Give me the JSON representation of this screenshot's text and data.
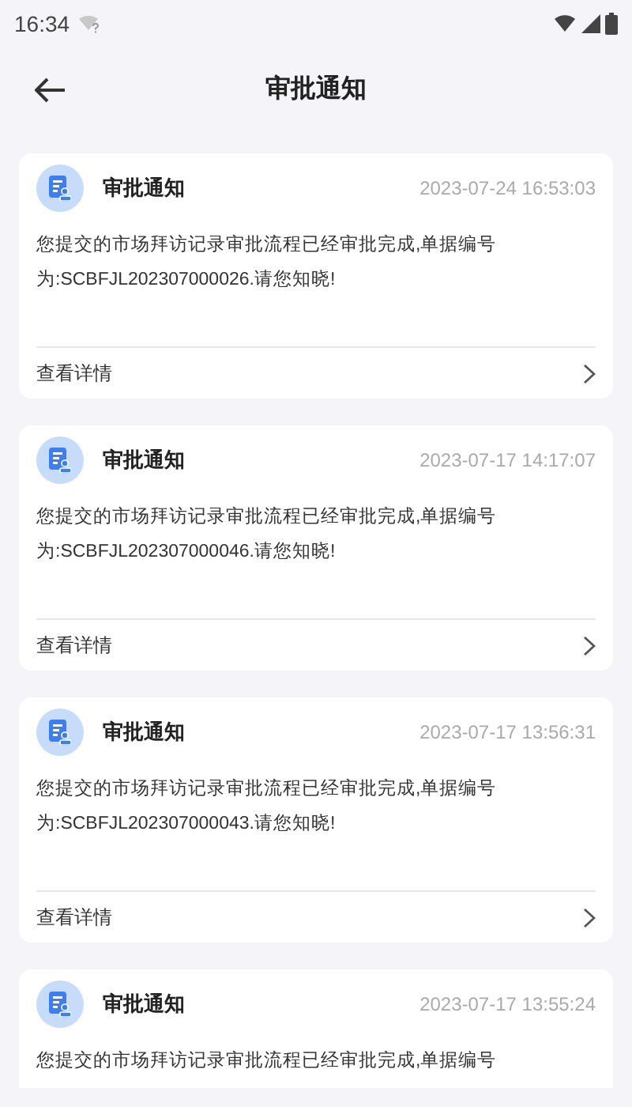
{
  "status_bar": {
    "time": "16:34"
  },
  "header": {
    "title": "审批通知"
  },
  "notifications": [
    {
      "title": "审批通知",
      "time": "2023-07-24 16:53:03",
      "body": "您提交的市场拜访记录审批流程已经审批完成,单据编号为:SCBFJL202307000026.请您知晓!",
      "link": "查看详情"
    },
    {
      "title": "审批通知",
      "time": "2023-07-17 14:17:07",
      "body": "您提交的市场拜访记录审批流程已经审批完成,单据编号为:SCBFJL202307000046.请您知晓!",
      "link": "查看详情"
    },
    {
      "title": "审批通知",
      "time": "2023-07-17 13:56:31",
      "body": "您提交的市场拜访记录审批流程已经审批完成,单据编号为:SCBFJL202307000043.请您知晓!",
      "link": "查看详情"
    },
    {
      "title": "审批通知",
      "time": "2023-07-17 13:55:24",
      "body": "您提交的市场拜访记录审批流程已经审批完成,单据编号"
    }
  ]
}
